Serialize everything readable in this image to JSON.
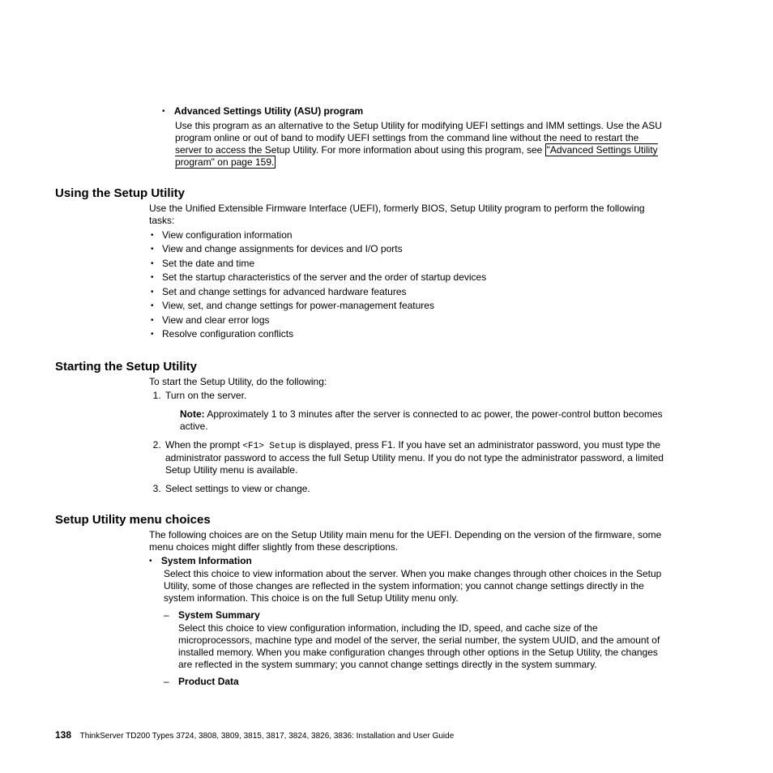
{
  "top_item": {
    "title": "Advanced Settings Utility (ASU) program",
    "desc_before_link": "Use this program as an alternative to the Setup Utility for modifying UEFI settings and IMM settings. Use the ASU program online or out of band to modify UEFI settings from the command line without the need to restart the server to access the Setup Utility. For more information about using this program, see ",
    "link_text": "\"Advanced Settings Utility program\" on page 159."
  },
  "sec1": {
    "heading": "Using the Setup Utility",
    "intro": "Use the Unified Extensible Firmware Interface (UEFI), formerly BIOS, Setup Utility program to perform the following tasks:",
    "bullets": [
      "View configuration information",
      "View and change assignments for devices and I/O ports",
      "Set the date and time",
      "Set the startup characteristics of the server and the order of startup devices",
      "Set and change settings for advanced hardware features",
      "View, set, and change settings for power-management features",
      "View and clear error logs",
      "Resolve configuration conflicts"
    ]
  },
  "sec2": {
    "heading": "Starting the Setup Utility",
    "intro": "To start the Setup Utility, do the following:",
    "steps": {
      "s1": "Turn on the server.",
      "note_label": "Note:",
      "note_text": "  Approximately 1 to 3 minutes after the server is connected to ac power, the power-control button becomes active.",
      "s2a": "When the prompt ",
      "s2_mono": "<F1> Setup",
      "s2b": " is displayed, press F1. If you have set an administrator password, you must type the administrator password to access the full Setup Utility menu. If you do not type the administrator password, a limited Setup Utility menu is available.",
      "s3": "Select settings to view or change."
    }
  },
  "sec3": {
    "heading": "Setup Utility menu choices",
    "intro": "The following choices are on the Setup Utility main menu for the UEFI. Depending on the version of the firmware, some menu choices might differ slightly from these descriptions.",
    "item1": {
      "title": "System Information",
      "desc": "Select this choice to view information about the server. When you make changes through other choices in the Setup Utility, some of those changes are reflected in the system information; you cannot change settings directly in the system information. This choice is on the full Setup Utility menu only.",
      "sub1_title": "System Summary",
      "sub1_desc": "Select this choice to view configuration information, including the ID, speed, and cache size of the microprocessors, machine type and model of the server, the serial number, the system UUID, and the amount of installed memory. When you make configuration changes through other options in the Setup Utility, the changes are reflected in the system summary; you cannot change settings directly in the system summary.",
      "sub2_title": "Product Data"
    }
  },
  "footer": {
    "page_number": "138",
    "text": "ThinkServer TD200 Types 3724, 3808, 3809, 3815, 3817, 3824, 3826, 3836: Installation and User Guide"
  }
}
